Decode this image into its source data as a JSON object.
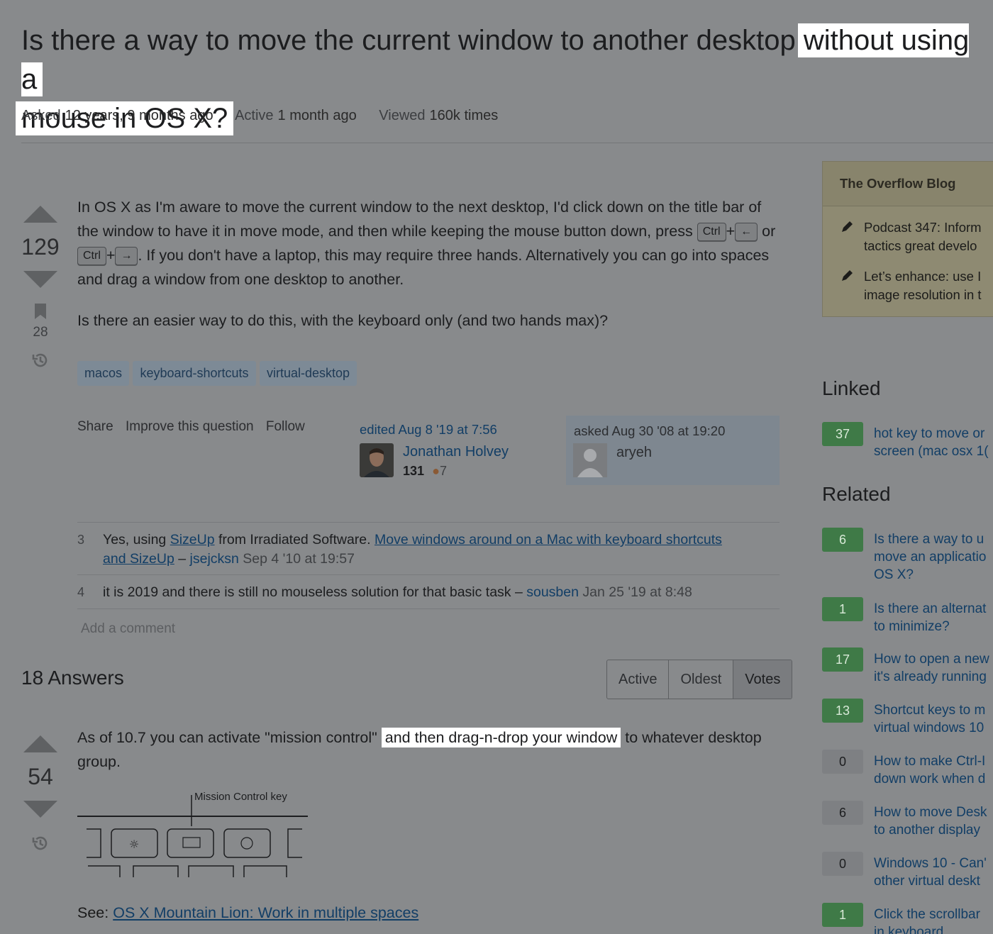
{
  "question": {
    "title_part1": "Is there a way to move the current window to another desktop",
    "title_part2": "without using a",
    "title_part3": "mouse in OS X?",
    "meta": {
      "asked_label": "Asked",
      "asked_value": "12 years, 9 months ago",
      "active_label": "Active",
      "active_value": "1 month ago",
      "viewed_label": "Viewed",
      "viewed_value": "160k times"
    },
    "votes": "129",
    "bookmarks": "28",
    "body": {
      "p1_a": "In OS X as I'm aware to move the current window to the next desktop, I'd click down on the title bar of the window to have it in move mode, and then while keeping the mouse button down, press",
      "kbd_ctrl": "Ctrl",
      "kbd_left": "←",
      "kbd_right": "→",
      "plus": "+",
      "or": "or",
      "p1_b": ". If you don't have a laptop, this may require three hands. Alternatively you can go into spaces and drag a window from one desktop to another.",
      "p2": "Is there an easier way to do this, with the keyboard only (and two hands max)?"
    },
    "tags": [
      "macos",
      "keyboard-shortcuts",
      "virtual-desktop"
    ],
    "menu": {
      "share": "Share",
      "improve": "Improve this question",
      "follow": "Follow"
    },
    "editor": {
      "action": "edited Aug 8 '19 at 7:56",
      "name": "Jonathan Holvey",
      "rep": "131",
      "bronze": "7"
    },
    "owner": {
      "action": "asked Aug 30 '08 at 19:20",
      "name": "aryeh"
    }
  },
  "comments": [
    {
      "score": "3",
      "text_a": "Yes, using ",
      "link1": "SizeUp",
      "text_b": " from Irradiated Software. ",
      "link2_line1": "Move windows around on a Mac with keyboard shortcuts",
      "link2_line2": "and SizeUp",
      "dash": " – ",
      "user": "jsejcksn",
      "date": "Sep 4 '10 at 19:57"
    },
    {
      "score": "4",
      "text": "it is 2019 and there is still no mouseless solution for that basic task",
      "dash": " – ",
      "user": "sousben",
      "date": "Jan 25 '19 at 8:48"
    }
  ],
  "add_comment": "Add a comment",
  "answers": {
    "heading": "18 Answers",
    "sort": [
      "Active",
      "Oldest",
      "Votes"
    ],
    "top": {
      "votes": "54",
      "text_a": "As of 10.7 you can activate \"mission control\"",
      "text_hl": "and then drag-n-drop your window",
      "text_b": "to whatever desktop group.",
      "figure_label": "Mission Control key",
      "see_label": "See:",
      "see_link": "OS X Mountain Lion: Work in multiple spaces"
    }
  },
  "sidebar": {
    "blog": {
      "title": "The Overflow Blog",
      "items": [
        {
          "line1": "Podcast 347: Inform",
          "line2": "tactics great develo"
        },
        {
          "line1": "Let’s enhance: use I",
          "line2": "image resolution in t"
        }
      ]
    },
    "linked_title": "Linked",
    "linked": [
      {
        "count": "37",
        "answered": true,
        "line1": "hot key to move or",
        "line2": "screen (mac osx 1("
      }
    ],
    "related_title": "Related",
    "related": [
      {
        "count": "6",
        "answered": true,
        "line1": "Is there a way to u",
        "line2": "move an applicatio",
        "line3": "OS X?"
      },
      {
        "count": "1",
        "answered": true,
        "line1": "Is there an alternat",
        "line2": "to minimize?"
      },
      {
        "count": "17",
        "answered": true,
        "line1": "How to open a new",
        "line2": "it's already running"
      },
      {
        "count": "13",
        "answered": true,
        "line1": "Shortcut keys to m",
        "line2": "virtual windows 10"
      },
      {
        "count": "0",
        "answered": false,
        "line1": "How to make Ctrl-I",
        "line2": "down work when d"
      },
      {
        "count": "6",
        "answered": false,
        "line1": "How to move Desk",
        "line2": "to another display"
      },
      {
        "count": "0",
        "answered": false,
        "line1": "Windows 10 - Can'",
        "line2": "other virtual deskt"
      },
      {
        "count": "1",
        "answered": true,
        "line1": "Click the scrollbar",
        "line2": "in keyboard"
      }
    ]
  },
  "icons": {
    "upvote": "upvote-arrow-icon",
    "downvote": "downvote-arrow-icon",
    "bookmark": "bookmark-icon",
    "history": "history-icon",
    "pencil": "pencil-icon"
  },
  "colors": {
    "overlay_bg": "#888a8c",
    "highlight": "#ffffff",
    "link": "#123e66",
    "answered_badge": "#3f7a47"
  }
}
